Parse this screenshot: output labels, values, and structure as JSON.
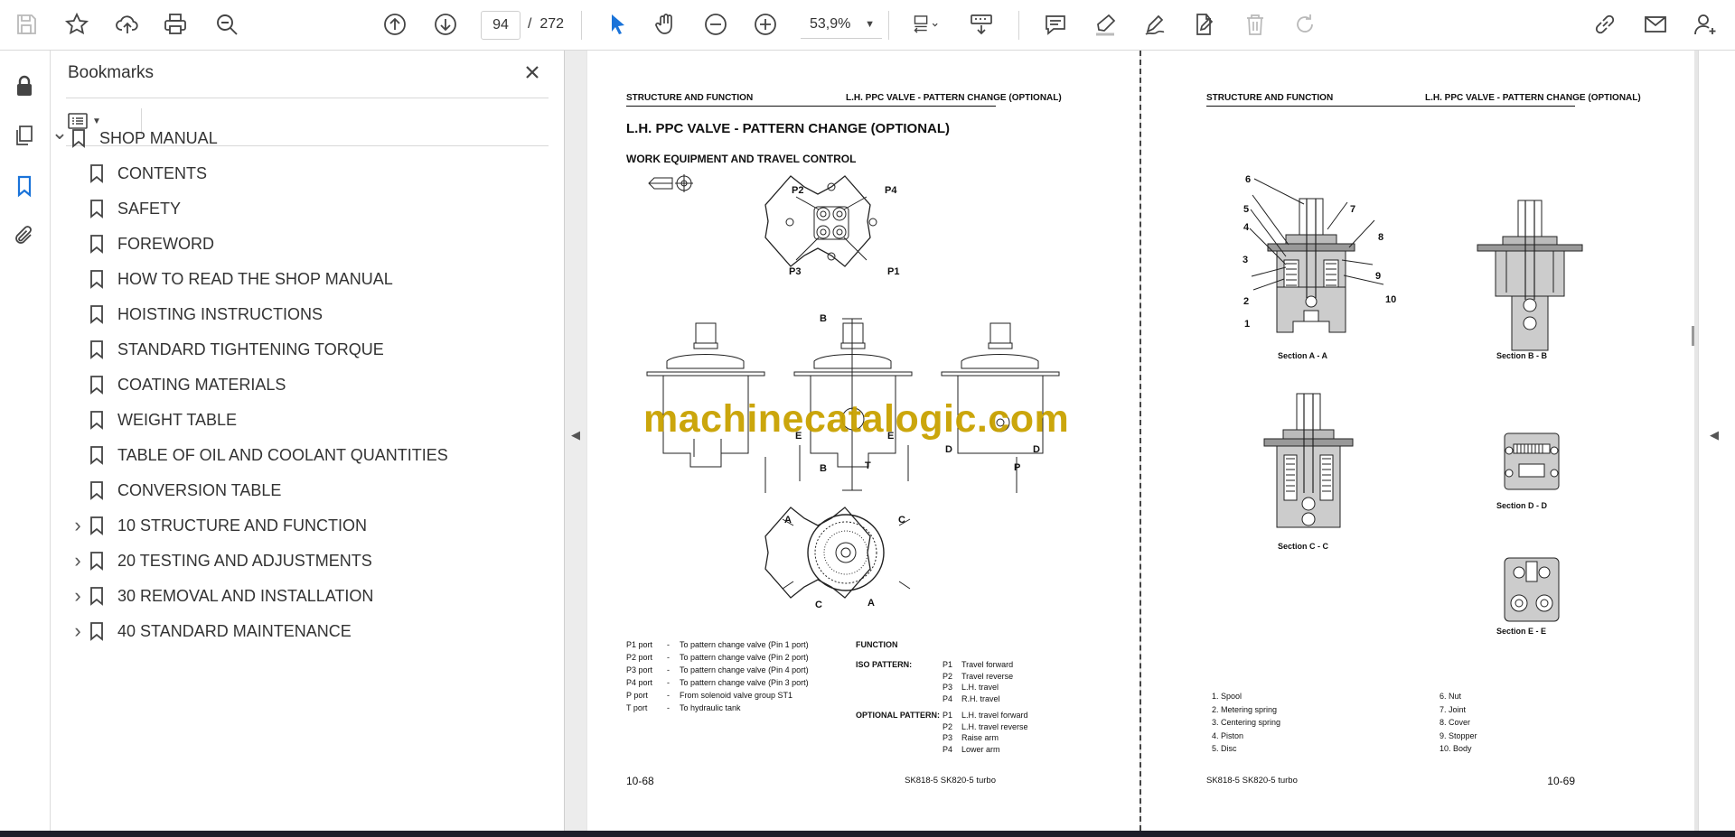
{
  "toolbar": {
    "page_current": "94",
    "page_separator": "/",
    "page_total": "272",
    "zoom": "53,9%"
  },
  "bookmarks": {
    "title": "Bookmarks",
    "items": [
      {
        "label": "SHOP MANUAL",
        "level": 0,
        "chevron": "expanded"
      },
      {
        "label": "CONTENTS",
        "level": 1,
        "chevron": "none"
      },
      {
        "label": "SAFETY",
        "level": 1,
        "chevron": "none"
      },
      {
        "label": "FOREWORD",
        "level": 1,
        "chevron": "none"
      },
      {
        "label": "HOW TO READ THE SHOP MANUAL",
        "level": 1,
        "chevron": "none"
      },
      {
        "label": "HOISTING INSTRUCTIONS",
        "level": 1,
        "chevron": "none"
      },
      {
        "label": "STANDARD TIGHTENING TORQUE",
        "level": 1,
        "chevron": "none"
      },
      {
        "label": "COATING MATERIALS",
        "level": 1,
        "chevron": "none"
      },
      {
        "label": "WEIGHT TABLE",
        "level": 1,
        "chevron": "none"
      },
      {
        "label": "TABLE OF OIL AND COOLANT QUANTITIES",
        "level": 1,
        "chevron": "none"
      },
      {
        "label": "CONVERSION TABLE",
        "level": 1,
        "chevron": "none"
      },
      {
        "label": "10 STRUCTURE AND FUNCTION",
        "level": 1,
        "chevron": "collapsed"
      },
      {
        "label": "20 TESTING AND ADJUSTMENTS",
        "level": 1,
        "chevron": "collapsed"
      },
      {
        "label": "30 REMOVAL AND INSTALLATION",
        "level": 1,
        "chevron": "collapsed"
      },
      {
        "label": "40 STANDARD MAINTENANCE",
        "level": 1,
        "chevron": "collapsed"
      }
    ]
  },
  "left_page": {
    "header_left": "STRUCTURE AND FUNCTION",
    "header_right": "L.H. PPC VALVE - PATTERN CHANGE (OPTIONAL)",
    "title": "L.H. PPC VALVE - PATTERN CHANGE (OPTIONAL)",
    "subtitle": "WORK EQUIPMENT AND TRAVEL CONTROL",
    "diagram_labels": {
      "p1": "P1",
      "p2": "P2",
      "p3": "P3",
      "p4": "P4",
      "a": "A",
      "b": "B",
      "c": "C",
      "d": "D",
      "e": "E",
      "p": "P",
      "t": "T"
    },
    "ports": [
      {
        "name": "P1 port",
        "dash": "-",
        "desc": "To pattern change valve (Pin 1 port)"
      },
      {
        "name": "P2 port",
        "dash": "-",
        "desc": "To pattern change valve (Pin 2 port)"
      },
      {
        "name": "P3 port",
        "dash": "-",
        "desc": "To pattern change valve (Pin 4 port)"
      },
      {
        "name": "P4 port",
        "dash": "-",
        "desc": "To pattern change valve (Pin 3 port)"
      },
      {
        "name": "P port",
        "dash": "-",
        "desc": "From solenoid valve group ST1"
      },
      {
        "name": "T port",
        "dash": "-",
        "desc": "To hydraulic tank"
      }
    ],
    "function_title": "FUNCTION",
    "iso_label": "ISO PATTERN:",
    "iso": [
      {
        "p": "P1",
        "d": "Travel forward"
      },
      {
        "p": "P2",
        "d": "Travel reverse"
      },
      {
        "p": "P3",
        "d": "L.H. travel"
      },
      {
        "p": "P4",
        "d": "R.H. travel"
      }
    ],
    "optional_label": "OPTIONAL PATTERN:",
    "optional": [
      {
        "p": "P1",
        "d": "L.H. travel forward"
      },
      {
        "p": "P2",
        "d": "L.H. travel reverse"
      },
      {
        "p": "P3",
        "d": "Raise arm"
      },
      {
        "p": "P4",
        "d": "Lower arm"
      }
    ],
    "footer_left": "10-68",
    "footer_right": "SK818-5  SK820-5 turbo"
  },
  "right_page": {
    "header_left": "STRUCTURE AND FUNCTION",
    "header_right": "L.H. PPC VALVE - PATTERN CHANGE (OPTIONAL)",
    "callouts": [
      "1",
      "2",
      "3",
      "4",
      "5",
      "6",
      "7",
      "8",
      "9",
      "10"
    ],
    "sections": {
      "aa": "Section A - A",
      "bb": "Section B - B",
      "cc": "Section C - C",
      "dd": "Section D - D",
      "ee": "Section E - E"
    },
    "parts_left": [
      "1.  Spool",
      "2.  Metering spring",
      "3.  Centering spring",
      "4.  Piston",
      "5.  Disc"
    ],
    "parts_right": [
      "6.  Nut",
      "7.  Joint",
      "8.  Cover",
      "9.  Stopper",
      "10.  Body"
    ],
    "footer_left": "SK818-5  SK820-5 turbo",
    "footer_right": "10-69"
  },
  "watermark": "machinecatalogic.com"
}
